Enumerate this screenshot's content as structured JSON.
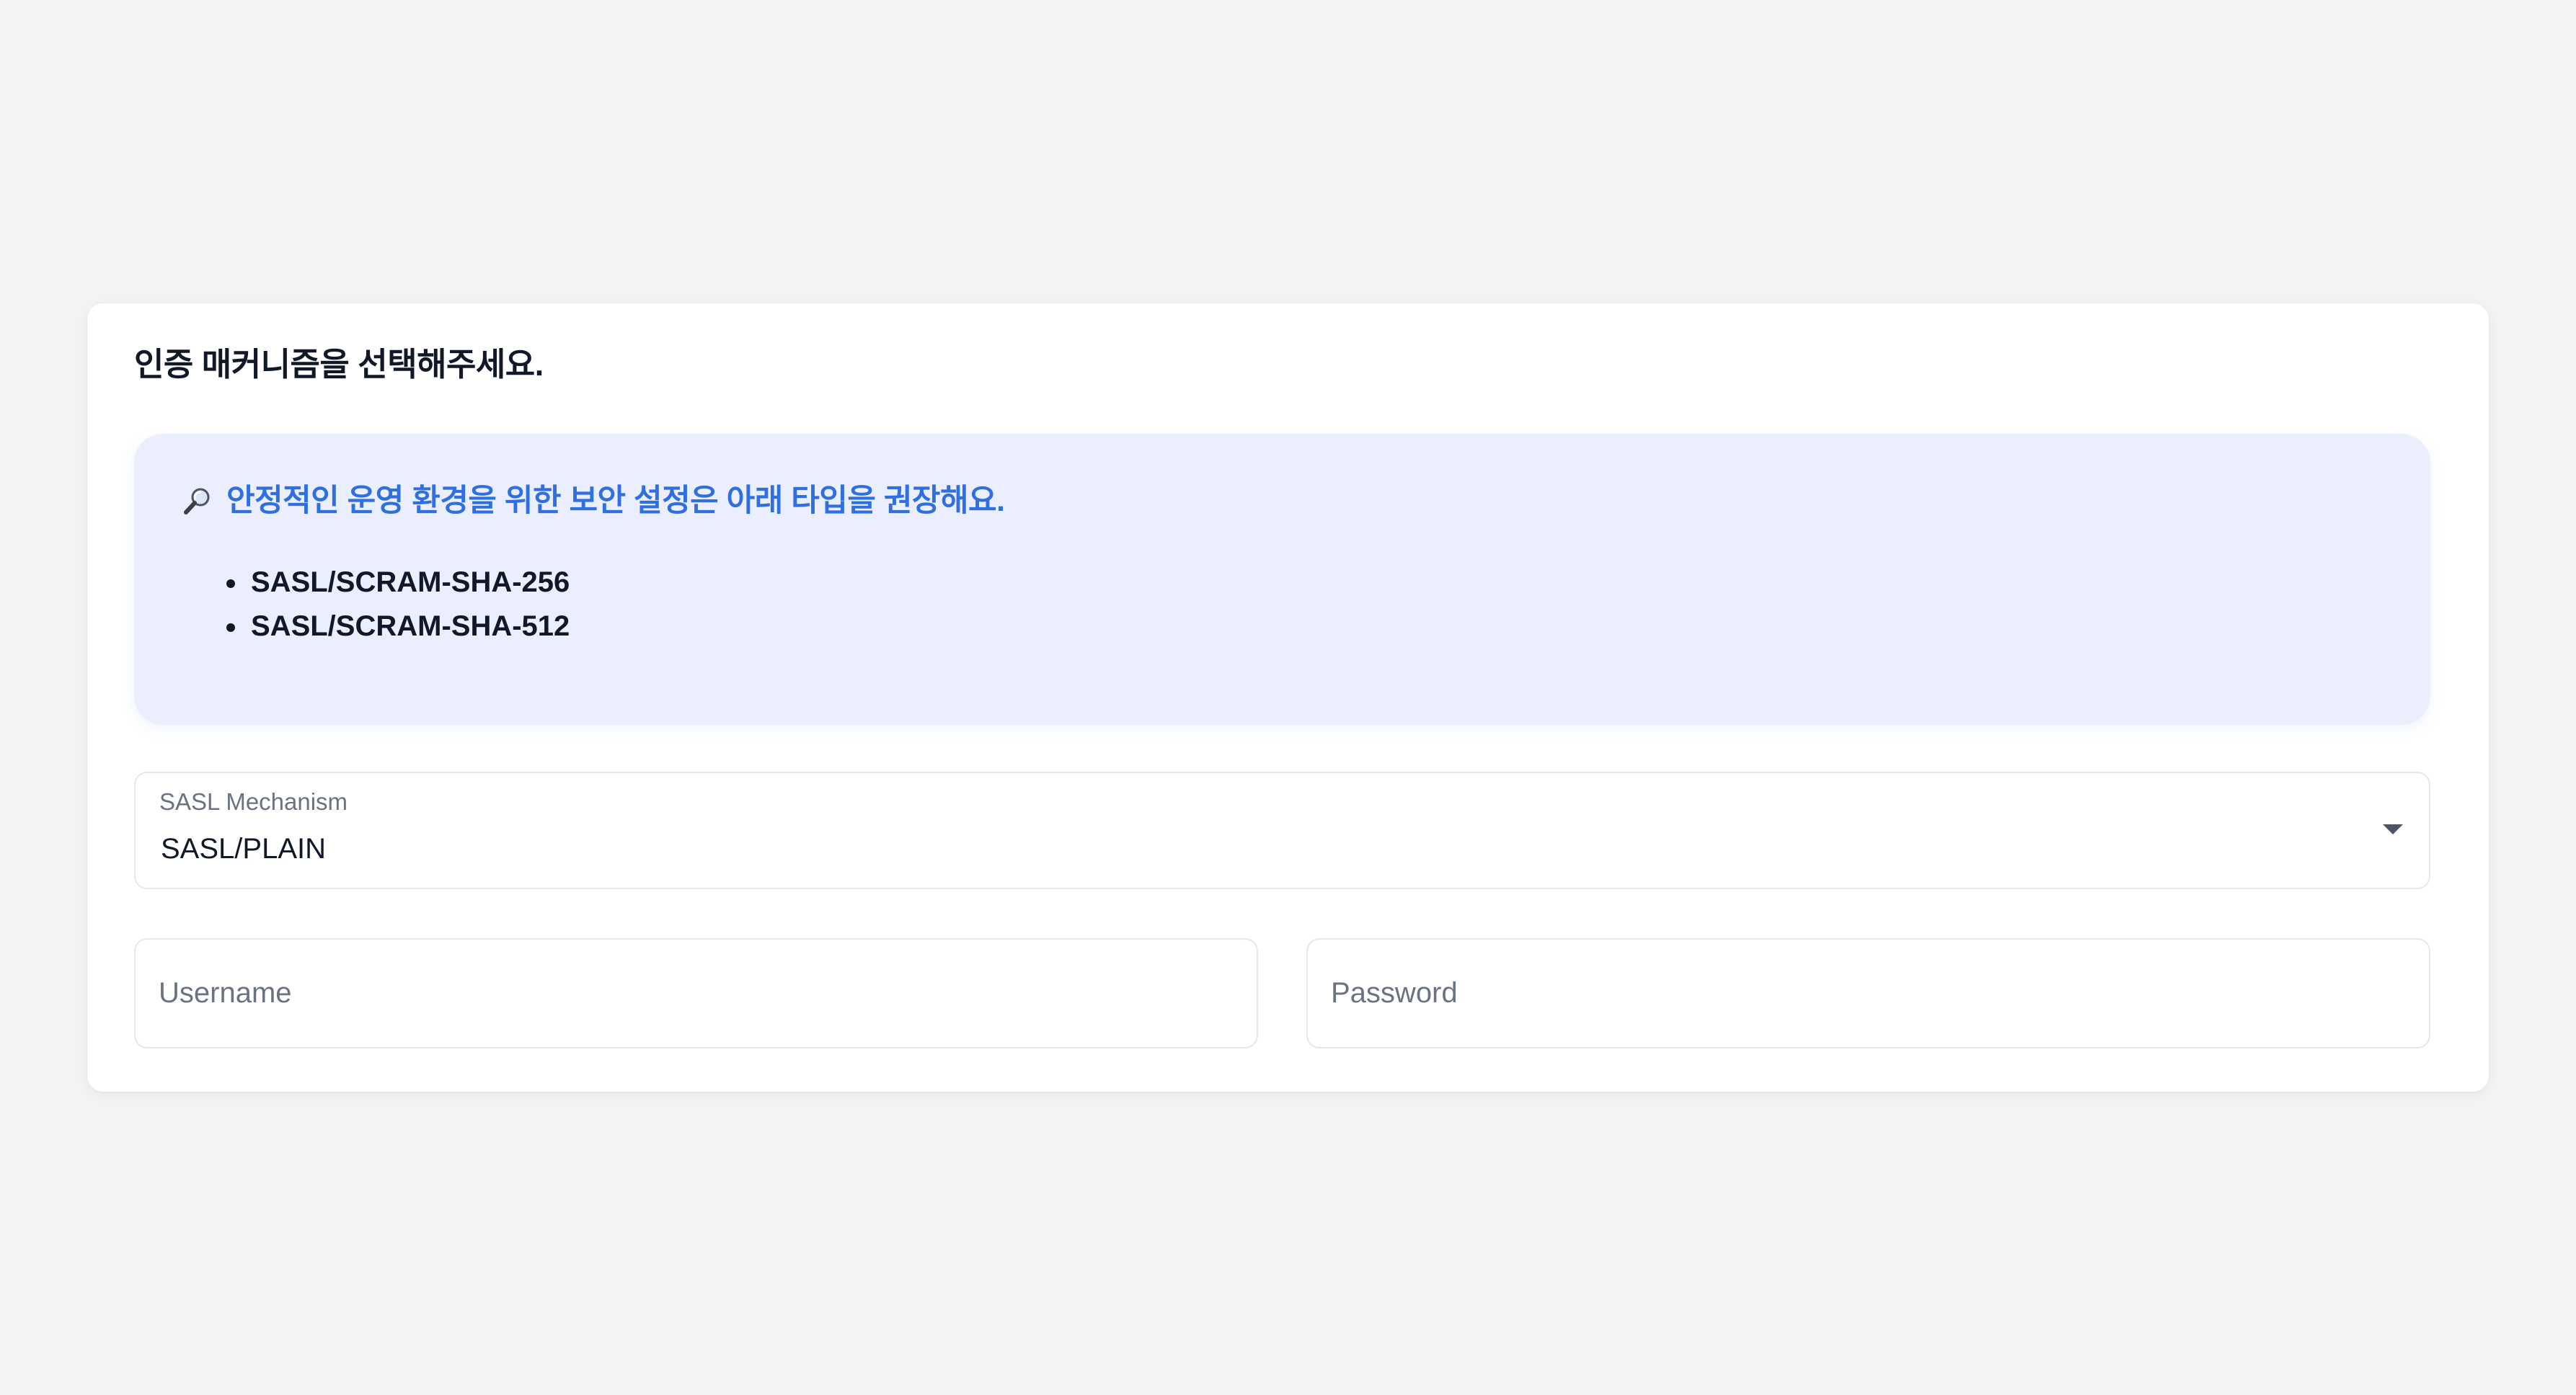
{
  "card": {
    "title": "인증 매커니즘을 선택해주세요."
  },
  "info": {
    "icon": "magnifying-glass-icon",
    "headline": "안정적인 운영 환경을 위한 보안 설정은 아래 타입을 권장해요.",
    "recommended": [
      "SASL/SCRAM-SHA-256",
      "SASL/SCRAM-SHA-512"
    ]
  },
  "mechanism": {
    "label": "SASL Mechanism",
    "selected": "SASL/PLAIN"
  },
  "credentials": {
    "username_placeholder": "Username",
    "password_placeholder": "Password"
  },
  "colors": {
    "background": "#f3f4f6",
    "card": "#ffffff",
    "info_background": "#eaeefd",
    "info_accent": "#2f6fe0",
    "text_primary": "#111827",
    "text_muted": "#6b7280",
    "border": "#e5e7eb"
  }
}
